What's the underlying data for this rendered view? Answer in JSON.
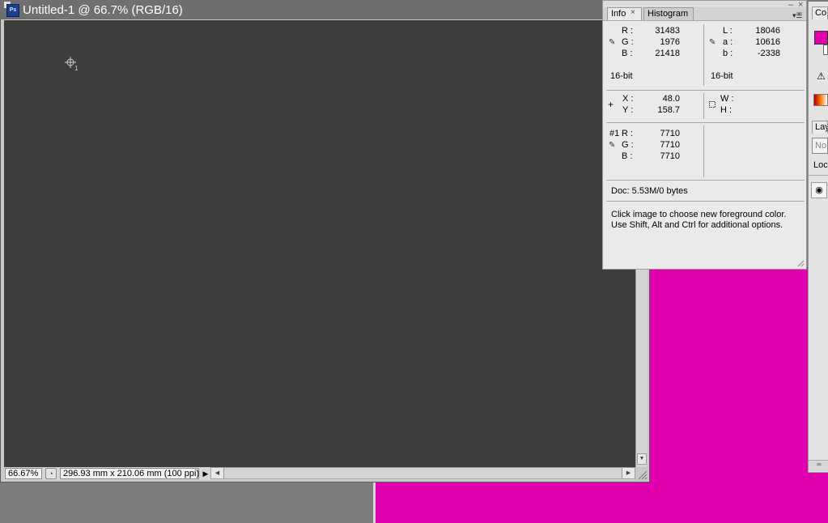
{
  "colors": {
    "magenta": "#e100ad",
    "canvas": "#3d3d3d",
    "desktop": "#7a7a7a"
  },
  "document": {
    "title": "Untitled-1 @ 66.7% (RGB/16)",
    "app_icon_text": "Ps",
    "sampler_number": "1",
    "status": {
      "zoom": "66.67%",
      "doc_size": "296.93 mm x 210.06 mm (100 ppi)"
    }
  },
  "info_panel": {
    "tabs": [
      {
        "label": "Info"
      },
      {
        "label": "Histogram"
      }
    ],
    "rgb": {
      "labels": [
        "R :",
        "G :",
        "B :"
      ],
      "values": [
        "31483",
        "1976",
        "21418"
      ],
      "bitdepth": "16-bit"
    },
    "lab": {
      "labels": [
        "L :",
        "a :",
        "b :"
      ],
      "values": [
        "18046",
        "10616",
        "-2338"
      ],
      "bitdepth": "16-bit"
    },
    "position": {
      "labels": [
        "X :",
        "Y :"
      ],
      "values": [
        "48.0",
        "158.7"
      ]
    },
    "size": {
      "labels": [
        "W :",
        "H :"
      ]
    },
    "sampler1": {
      "prefix": "#1",
      "labels": [
        "R :",
        "G :",
        "B :"
      ],
      "values": [
        "7710",
        "7710",
        "7710"
      ]
    },
    "doc_info": "Doc: 5.53M/0 bytes",
    "hint_line1": "Click image to choose new foreground color.",
    "hint_line2": "Use Shift, Alt and Ctrl for additional options."
  },
  "color_panel": {
    "tab_label": "Co"
  },
  "layers_panel": {
    "tab_label": "Lay",
    "blend_mode": "No",
    "lock_label": "Lock"
  }
}
